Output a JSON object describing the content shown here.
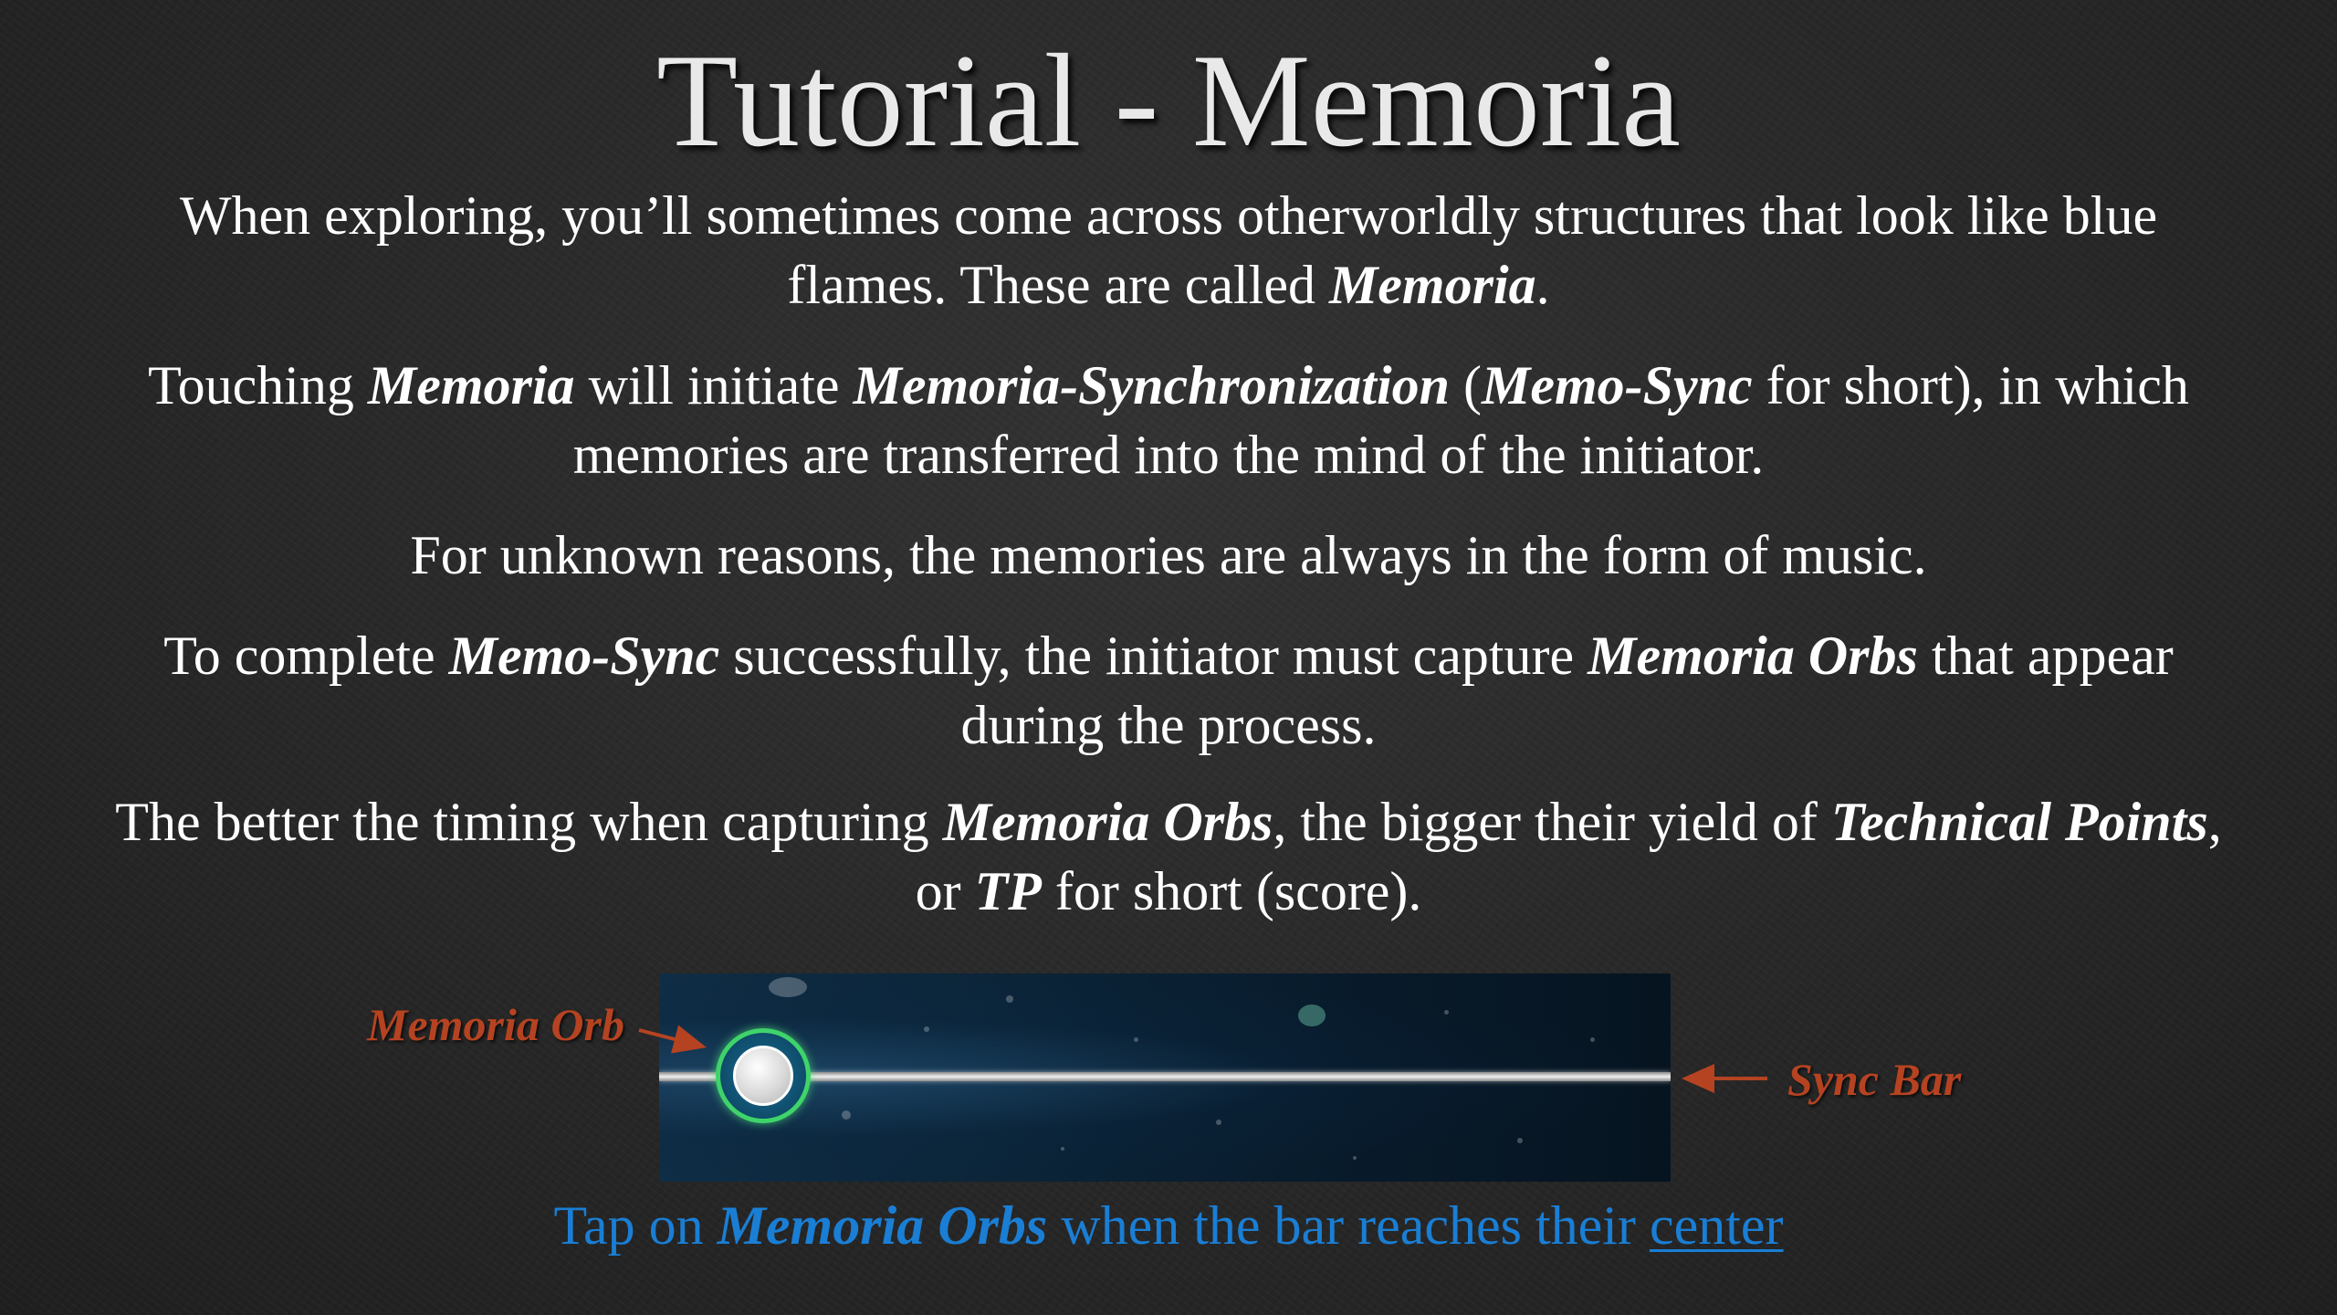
{
  "title": "Tutorial - Memoria",
  "paragraphs": {
    "p1": {
      "t1": "When exploring, you’ll sometimes come across otherworldly structures that look like blue flames. These are called ",
      "e1": "Memoria",
      "t2": "."
    },
    "p2": {
      "t1": "Touching ",
      "e1": "Memoria",
      "t2": " will initiate ",
      "e2": "Memoria-Synchronization",
      "t3": " (",
      "e3": "Memo-Sync",
      "t4": " for short), in which memories are transferred into the mind of the initiator."
    },
    "p3": {
      "t1": "For unknown reasons, the memories are always in the form of music."
    },
    "p4": {
      "t1": "To complete ",
      "e1": "Memo-Sync",
      "t2": " successfully, the initiator must capture ",
      "e2": "Memoria Orbs",
      "t3": " that appear during the process."
    },
    "p5": {
      "t1": "The better the timing when capturing ",
      "e1": "Memoria Orbs",
      "t2": ", the bigger their yield of ",
      "e2": "Technical Points",
      "t3": ", or ",
      "e3": "TP",
      "t4": " for short (score)."
    }
  },
  "diagram": {
    "orb_label": "Memoria Orb",
    "bar_label": "Sync Bar",
    "orb_icon": "memoria-orb-icon",
    "callout_color": "#b54321",
    "orb_ring_color": "#3fd46a"
  },
  "hint": {
    "t1": "Tap on ",
    "e1": "Memoria Orbs",
    "t2": " when the bar reaches their ",
    "link": "center",
    "color": "#1a7ed4"
  }
}
